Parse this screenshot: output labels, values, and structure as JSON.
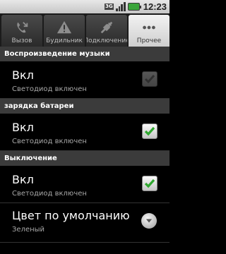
{
  "status_bar": {
    "network": "3G",
    "time": "12:23"
  },
  "tabs": [
    {
      "label": "Вызов",
      "icon": "phone-missed-icon",
      "active": false
    },
    {
      "label": "Будильник",
      "icon": "warning-icon",
      "active": false
    },
    {
      "label": "Подключение",
      "icon": "plug-icon",
      "active": false
    },
    {
      "label": "Прочее",
      "icon": "more-dots-icon",
      "active": true
    }
  ],
  "sections": [
    {
      "header": "Воспроизведение музыки",
      "rows": [
        {
          "title": "Вкл",
          "subtitle": "Светодиод включен",
          "control": "checkbox",
          "checked": true,
          "enabled": false
        }
      ]
    },
    {
      "header": "зарядка батареи",
      "rows": [
        {
          "title": "Вкл",
          "subtitle": "Светодиод включен",
          "control": "checkbox",
          "checked": true,
          "enabled": true
        }
      ]
    },
    {
      "header": "Выключение",
      "rows": [
        {
          "title": "Вкл",
          "subtitle": "Светодиод включен",
          "control": "checkbox",
          "checked": true,
          "enabled": true
        },
        {
          "title": "Цвет по умолчанию",
          "subtitle": "Зеленый",
          "control": "dropdown"
        }
      ]
    }
  ],
  "colors": {
    "check_green": "#2fa82f",
    "header_bg": "#3b3b3b",
    "active_tab": "#e6e6e6"
  }
}
